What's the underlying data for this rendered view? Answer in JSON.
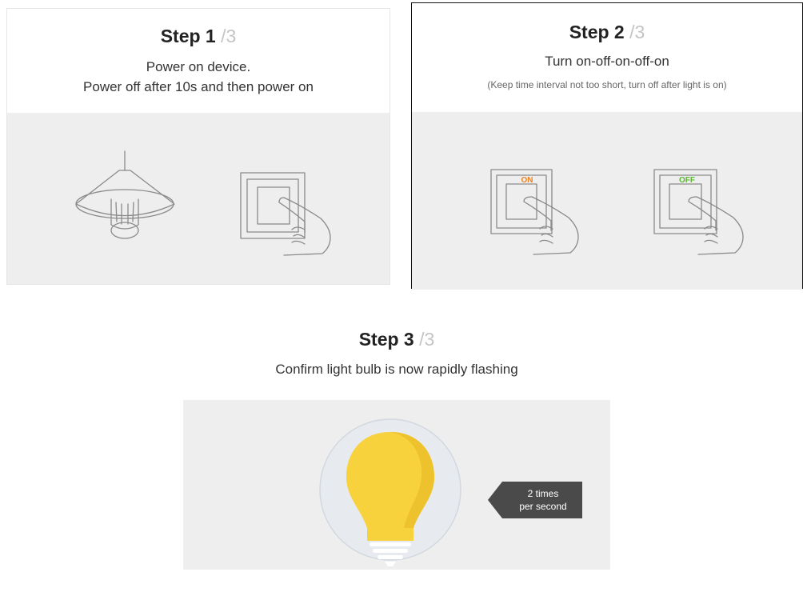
{
  "steps": [
    {
      "title": "Step 1",
      "total": "/3",
      "lines": [
        "Power on device.",
        "Power off after 10s and then power on"
      ]
    },
    {
      "title": "Step 2",
      "total": "/3",
      "lines": [
        "Turn on-off-on-off-on"
      ],
      "note": "(Keep time interval not too short, turn off after light is on)",
      "switch_labels": {
        "on": "ON",
        "off": "OFF"
      }
    },
    {
      "title": "Step 3",
      "total": "/3",
      "lines": [
        "Confirm light bulb is now rapidly flashing"
      ],
      "badge": {
        "line1": "2 times",
        "line2": "per second"
      }
    }
  ],
  "colors": {
    "illustration_bg": "#eeeeee",
    "line_art": "#8a8a8a",
    "on_label": "#f0801e",
    "off_label": "#5cb531",
    "bulb": "#f7d23c",
    "badge": "#4a4a4a"
  }
}
